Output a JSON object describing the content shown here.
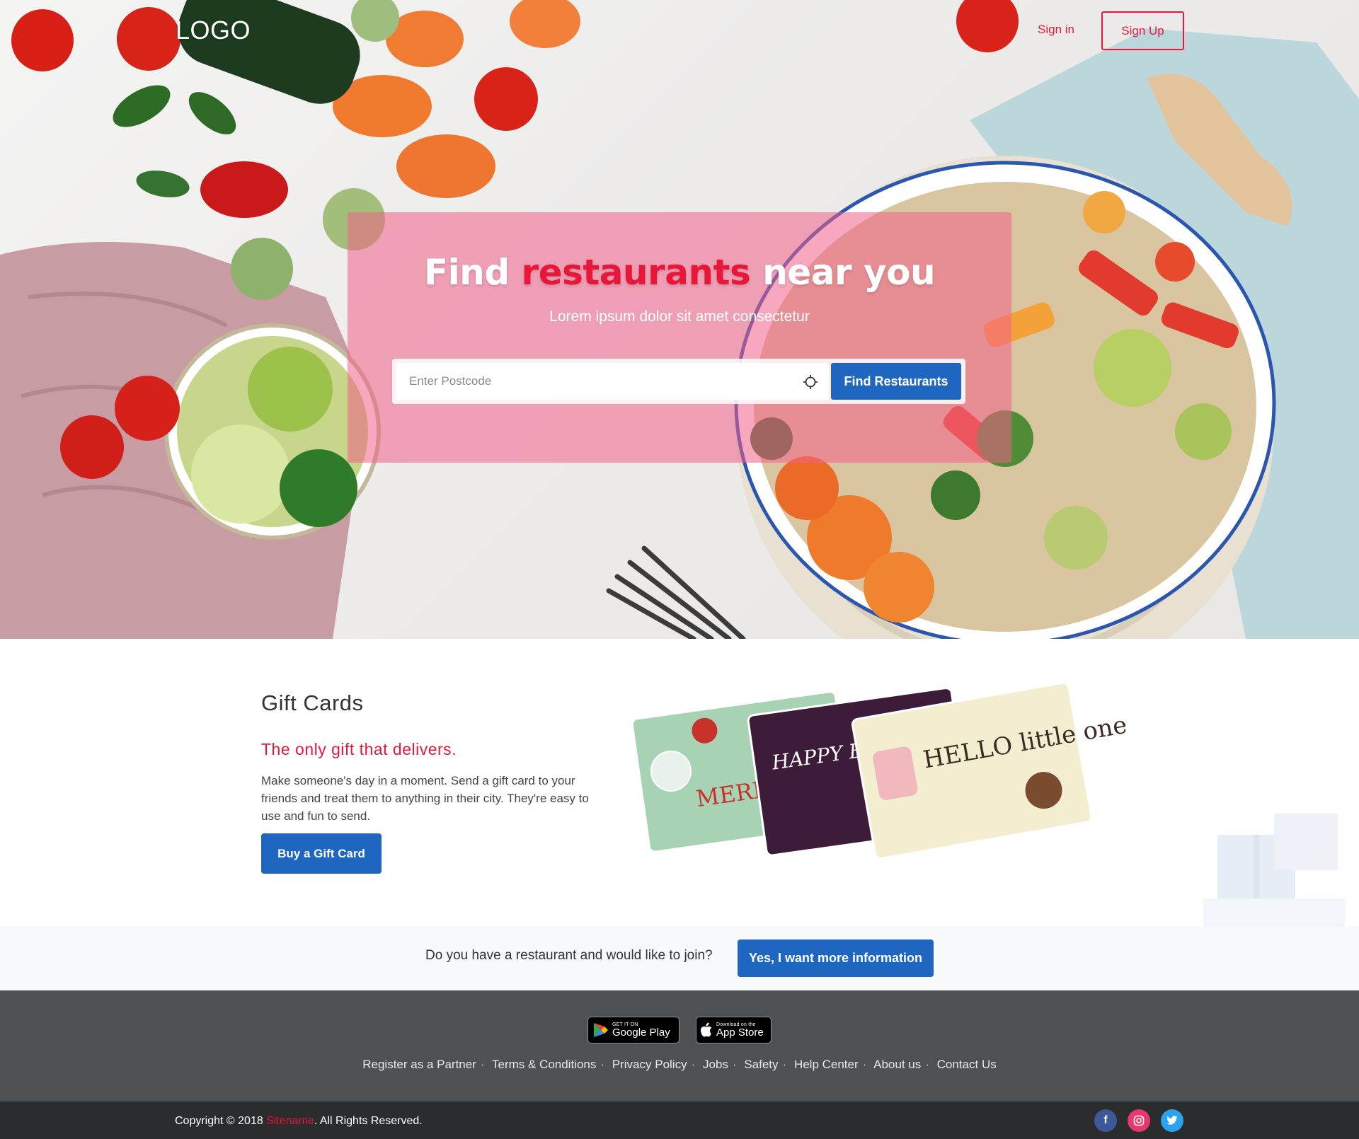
{
  "header": {
    "logo": "LOGO",
    "signin_label": "Sign in",
    "signup_label": "Sign Up"
  },
  "hero": {
    "title_part1": "Find",
    "title_accent": "restaurants",
    "title_part2": "near you",
    "subtitle": "Lorem ipsum dolor sit amet consectetur",
    "postcode_placeholder": "Enter Postcode",
    "search_button": "Find Restaurants"
  },
  "gift": {
    "title": "Gift Cards",
    "tagline": "The only gift that delivers.",
    "description": "Make someone's day in a moment. Send a gift card to your friends and treat them to anything in their city. They're easy to use and fun to send.",
    "button": "Buy a Gift Card",
    "card_texts": [
      "MERRY CHRISTMAS",
      "HAPPY Birthday MOM",
      "HELLO little one"
    ]
  },
  "join": {
    "question": "Do you have a restaurant and would like to join?",
    "button": "Yes, I want more information"
  },
  "footer": {
    "google_play_small": "GET IT ON",
    "google_play_big": "Google Play",
    "app_store_small": "Download on the",
    "app_store_big": "App Store",
    "links": [
      "Register as a Partner",
      "Terms & Conditions",
      "Privacy Policy",
      "Jobs",
      "Safety",
      "Help Center",
      "About us",
      "Contact Us"
    ],
    "copyright_prefix": "Copyright © 2018 ",
    "sitename": "Sitename",
    "copyright_suffix": ". All Rights Reserved.",
    "social": [
      {
        "name": "facebook-icon",
        "glyph": "f"
      },
      {
        "name": "instagram-icon",
        "glyph": "◎"
      },
      {
        "name": "twitter-icon",
        "glyph": "🐦"
      }
    ]
  },
  "colors": {
    "accent_red": "#e8173a",
    "primary_blue": "#1f66c1",
    "footer_bg": "#4d5154",
    "bottom_bar_bg": "#2a2c2e"
  }
}
